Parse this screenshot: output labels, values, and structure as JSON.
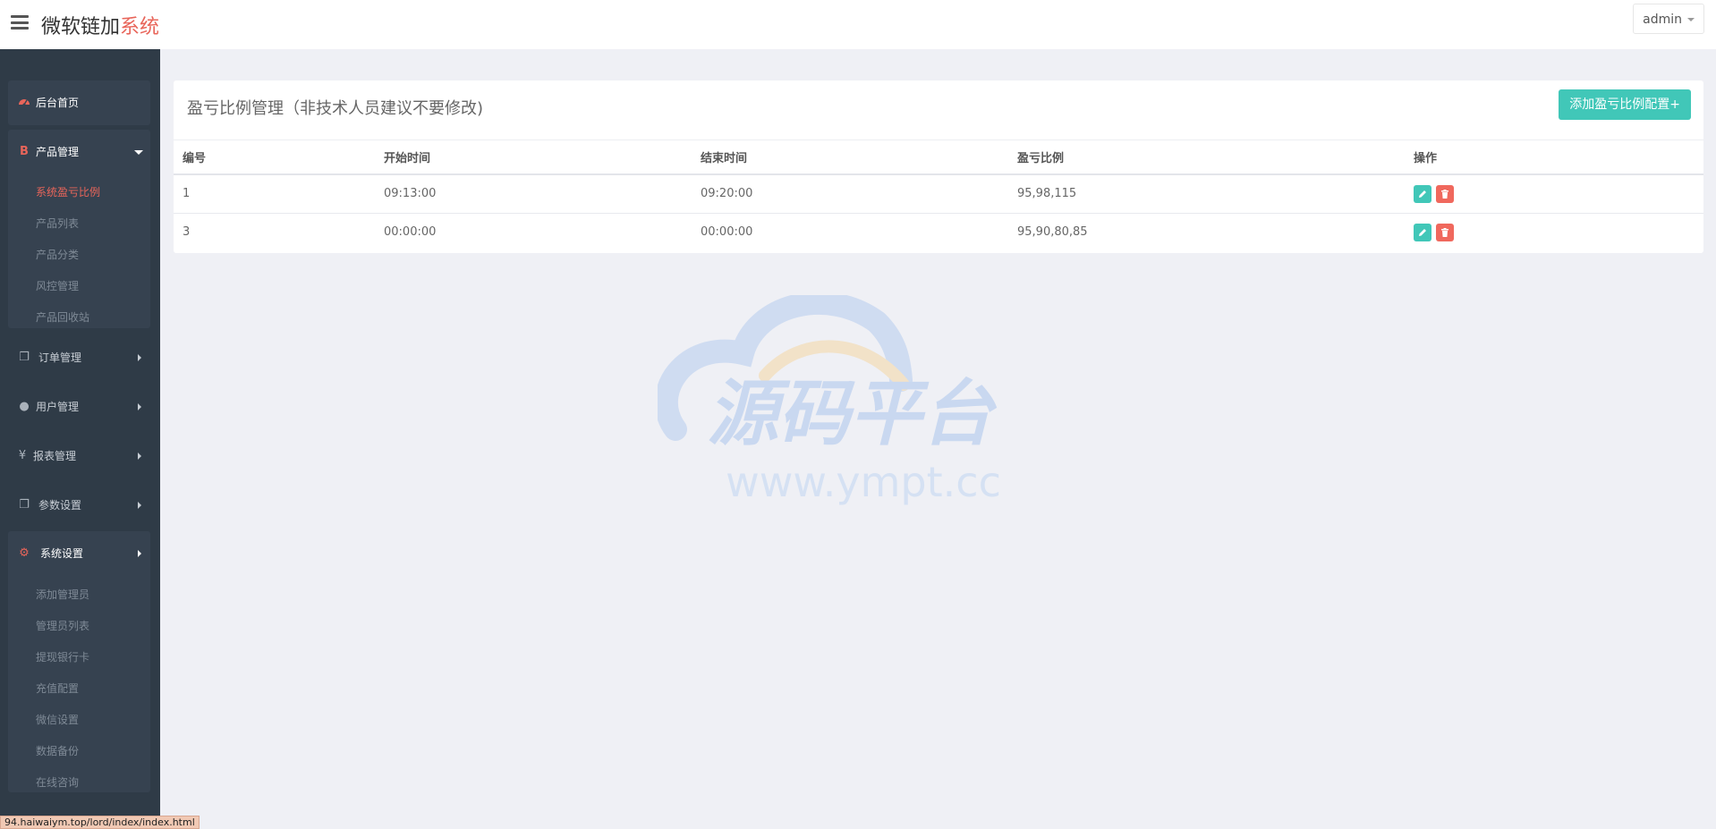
{
  "header": {
    "brand_main": "微软链加",
    "brand_highlight": "系统",
    "user_menu": "admin"
  },
  "sidebar": {
    "home": "后台首页",
    "product": {
      "label": "产品管理",
      "items": [
        "系统盈亏比例",
        "产品列表",
        "产品分类",
        "风控管理",
        "产品回收站"
      ]
    },
    "orders": "订单管理",
    "users": "用户管理",
    "reports": "报表管理",
    "params": "参数设置",
    "system": {
      "label": "系统设置",
      "items": [
        "添加管理员",
        "管理员列表",
        "提现银行卡",
        "充值配置",
        "微信设置",
        "数据备份",
        "在线咨询"
      ]
    }
  },
  "status_url": "94.haiwaiym.top/lord/index/index.html",
  "panel": {
    "title": "盈亏比例管理（非技术人员建议不要修改)",
    "add_button": "添加盈亏比例配置+",
    "columns": [
      "编号",
      "开始时间",
      "结束时间",
      "盈亏比例",
      "操作"
    ],
    "rows": [
      {
        "id": "1",
        "start": "09:13:00",
        "end": "09:20:00",
        "ratio": "95,98,115"
      },
      {
        "id": "3",
        "start": "00:00:00",
        "end": "00:00:00",
        "ratio": "95,90,80,85"
      }
    ]
  },
  "watermark": {
    "title": "源码平台",
    "url": "www.ympt.cc"
  },
  "colors": {
    "accent_teal": "#41c7b8",
    "accent_red": "#e8655a",
    "sidebar_bg": "#2f3b47"
  }
}
